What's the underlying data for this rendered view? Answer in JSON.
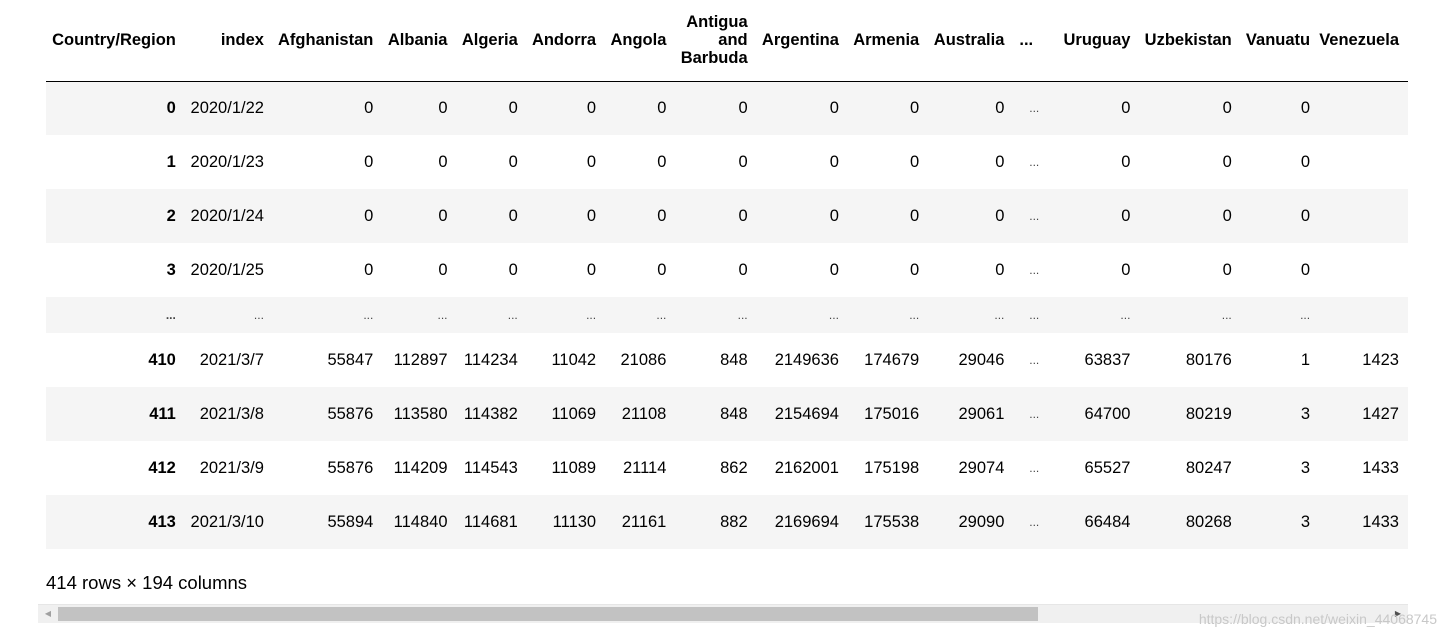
{
  "table": {
    "columns": [
      "Country/Region",
      "index",
      "Afghanistan",
      "Albania",
      "Algeria",
      "Andorra",
      "Angola",
      "Antigua and Barbuda",
      "Argentina",
      "Armenia",
      "Australia",
      "...",
      "Uruguay",
      "Uzbekistan",
      "Vanuatu",
      "Venezuela"
    ],
    "rows": [
      [
        "0",
        "2020/1/22",
        "0",
        "0",
        "0",
        "0",
        "0",
        "0",
        "0",
        "0",
        "0",
        "...",
        "0",
        "0",
        "0",
        ""
      ],
      [
        "1",
        "2020/1/23",
        "0",
        "0",
        "0",
        "0",
        "0",
        "0",
        "0",
        "0",
        "0",
        "...",
        "0",
        "0",
        "0",
        ""
      ],
      [
        "2",
        "2020/1/24",
        "0",
        "0",
        "0",
        "0",
        "0",
        "0",
        "0",
        "0",
        "0",
        "...",
        "0",
        "0",
        "0",
        ""
      ],
      [
        "3",
        "2020/1/25",
        "0",
        "0",
        "0",
        "0",
        "0",
        "0",
        "0",
        "0",
        "0",
        "...",
        "0",
        "0",
        "0",
        ""
      ],
      [
        "...",
        "...",
        "...",
        "...",
        "...",
        "...",
        "...",
        "...",
        "...",
        "...",
        "...",
        "...",
        "...",
        "...",
        "...",
        ""
      ],
      [
        "410",
        "2021/3/7",
        "55847",
        "112897",
        "114234",
        "11042",
        "21086",
        "848",
        "2149636",
        "174679",
        "29046",
        "...",
        "63837",
        "80176",
        "1",
        "1423"
      ],
      [
        "411",
        "2021/3/8",
        "55876",
        "113580",
        "114382",
        "11069",
        "21108",
        "848",
        "2154694",
        "175016",
        "29061",
        "...",
        "64700",
        "80219",
        "3",
        "1427"
      ],
      [
        "412",
        "2021/3/9",
        "55876",
        "114209",
        "114543",
        "11089",
        "21114",
        "862",
        "2162001",
        "175198",
        "29074",
        "...",
        "65527",
        "80247",
        "3",
        "1433"
      ],
      [
        "413",
        "2021/3/10",
        "55894",
        "114840",
        "114681",
        "11130",
        "21161",
        "882",
        "2169694",
        "175538",
        "29090",
        "...",
        "66484",
        "80268",
        "3",
        "1433"
      ]
    ]
  },
  "shape_text": "414 rows × 194 columns",
  "scrollbar": {
    "left_arrow_icon": "◀",
    "right_arrow_icon": "▶"
  },
  "watermark": "https://blog.csdn.net/weixin_44068745"
}
